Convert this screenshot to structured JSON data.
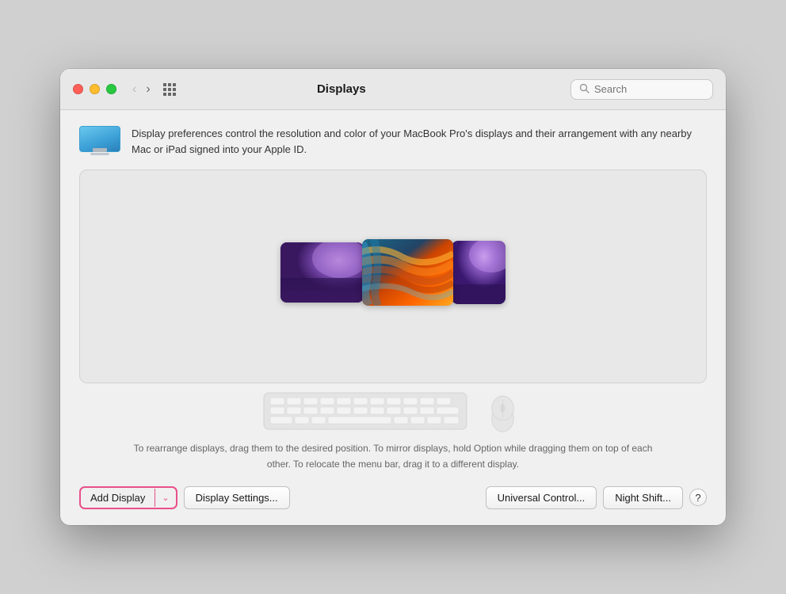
{
  "window": {
    "title": "Displays"
  },
  "titlebar": {
    "back_button": "‹",
    "forward_button": "›",
    "search_placeholder": "Search"
  },
  "info_banner": {
    "text": "Display preferences control the resolution and color of your MacBook Pro's displays and their arrangement with any nearby Mac or iPad signed into your Apple ID."
  },
  "help_text": "To rearrange displays, drag them to the desired position. To mirror displays, hold Option while dragging them on top of each other. To relocate the menu bar, drag it to a different display.",
  "buttons": {
    "add_display": "Add Display",
    "display_settings": "Display Settings...",
    "universal_control": "Universal Control...",
    "night_shift": "Night Shift...",
    "help": "?"
  },
  "displays": [
    {
      "id": "display-1",
      "type": "macbook"
    },
    {
      "id": "display-2",
      "type": "external-main"
    },
    {
      "id": "display-3",
      "type": "external-side"
    }
  ]
}
